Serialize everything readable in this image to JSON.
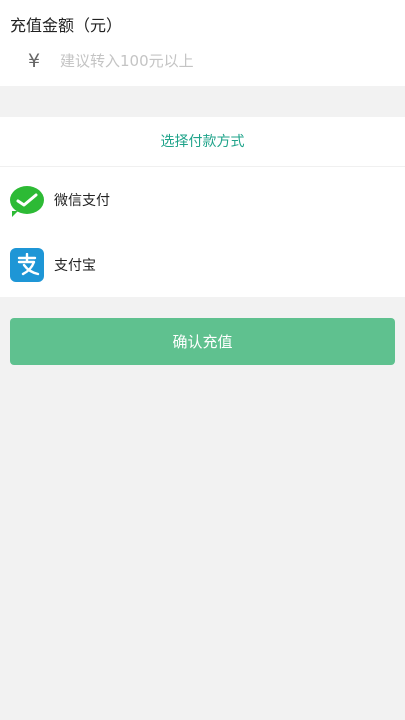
{
  "amount": {
    "title": "充值金额（元）",
    "currency_symbol": "¥",
    "input_value": "",
    "placeholder": "建议转入100元以上"
  },
  "payment": {
    "header": "选择付款方式",
    "options": [
      {
        "label": "微信支付",
        "icon": "wechat-pay-icon"
      },
      {
        "label": "支付宝",
        "icon": "alipay-icon"
      }
    ]
  },
  "confirm_label": "确认充值",
  "colors": {
    "accent": "#1fa38a",
    "button": "#5fc18f",
    "wechat": "#2dba35",
    "alipay": "#1e96d6",
    "background": "#f2f2f2"
  }
}
